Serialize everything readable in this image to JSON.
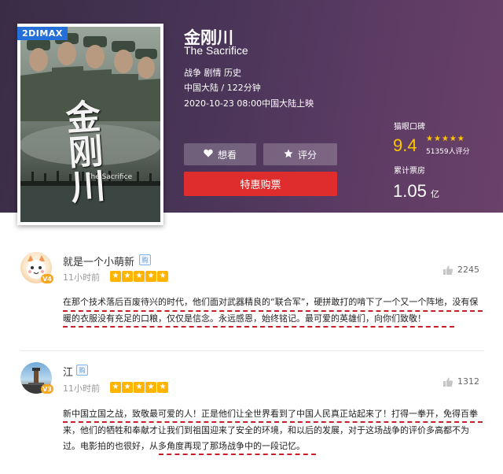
{
  "movie": {
    "badge": "2DIMAX",
    "poster_title": "金刚川",
    "poster_en": "The Sacrifice",
    "title": "金刚川",
    "subtitle": "The Sacrifice",
    "genres": "战争 剧情 历史",
    "region_duration": "中国大陆 / 122分钟",
    "release": "2020-10-23 08:00中国大陆上映"
  },
  "actions": {
    "want_label": "想看",
    "rate_label": "评分",
    "buy_label": "特惠购票"
  },
  "stats": {
    "rating_label": "猫眼口碑",
    "score": "9.4",
    "rating_count": "51359人评分",
    "box_label": "累计票房",
    "box_value": "1.05",
    "box_unit": "亿"
  },
  "comments": [
    {
      "user": "就是一个小萌新",
      "level_badge": "V4",
      "time": "11小时前",
      "stars": 5,
      "likes": "2245",
      "text": "在那个技术落后百废待兴的时代，他们面对武器精良的“联合军”，硬拼敢打的啃下了一个又一个阵地，没有保暖的衣服没有充足的口粮，仅仅是信念。永远感恩，始终铭记。最可爱的英雄们，向你们致敬！"
    },
    {
      "user": "江",
      "level_badge": "V3",
      "time": "11小时前",
      "stars": 5,
      "likes": "1312",
      "text": "新中国立国之战，致敬最可爱的人！正是他们让全世界看到了中国人民真正站起来了！打得一拳开，免得百拳来，他们的牺牲和奉献才让我们到祖国迎来了安全的环境，和以后的发展，对于这场战争的评价多高都不为过。电影拍的也很好，从多角度再现了那场战争中的一段记忆。"
    }
  ],
  "colors": {
    "accent_red": "#df2d2d",
    "score_yellow": "#ffc600",
    "star_orange": "#ffb400",
    "annotation_red": "#c8202a"
  }
}
